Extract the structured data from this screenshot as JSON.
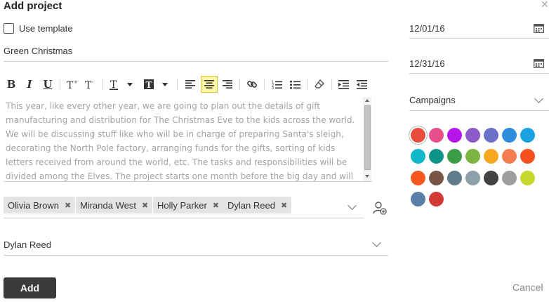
{
  "dialog": {
    "title": "Add project"
  },
  "template": {
    "label": "Use template",
    "checked": false
  },
  "project": {
    "name": "Green Christmas",
    "description": "This year, like every other year, we are going to plan out the details of gift manufacturing and distribution for The Christmas Eve to the kids across the world. We will be discussing stuff like who will be in charge of preparing Santa's sleigh, decorating the North Pole factory, arranging funds for the gifts, sorting of kids letters received from around the world, etc. The tasks and responsibilities will be divided among the Elves. The project starts one month before the big day and will wrap-up after New Year's Eve."
  },
  "toolbar": {
    "buttons": [
      "bold",
      "italic",
      "underline",
      "superscript",
      "subscript",
      "font-size",
      "font-color",
      "align-left",
      "align-center",
      "align-right",
      "link",
      "numbered-list",
      "bulleted-list",
      "clear-format",
      "indent",
      "outdent"
    ],
    "bold_glyph": "B",
    "italic_glyph": "I",
    "underline_glyph": "U",
    "active": "align-center"
  },
  "members": [
    {
      "name": "Olivia Brown"
    },
    {
      "name": "Miranda West"
    },
    {
      "name": "Holly Parker"
    },
    {
      "name": "Dylan Reed"
    }
  ],
  "owner": {
    "value": "Dylan Reed"
  },
  "dates": {
    "start": "12/01/16",
    "end": "12/31/16"
  },
  "group": {
    "value": "Campaigns"
  },
  "colors": {
    "selected_index": 0,
    "swatches": [
      "#e84c3d",
      "#e84e8a",
      "#b515e8",
      "#8b5bc7",
      "#6a71c6",
      "#2b8ddb",
      "#1ba2e0",
      "#10b8c8",
      "#0d9488",
      "#3c9c45",
      "#7cb342",
      "#f7a820",
      "#f47d4f",
      "#f4511e",
      "#f5591f",
      "#795548",
      "#607d8b",
      "#8ea1ab",
      "#424242",
      "#9e9e9e",
      "#c6d82e",
      "#5b7ea8",
      "#d23a35"
    ]
  },
  "actions": {
    "add": "Add",
    "cancel": "Cancel"
  }
}
